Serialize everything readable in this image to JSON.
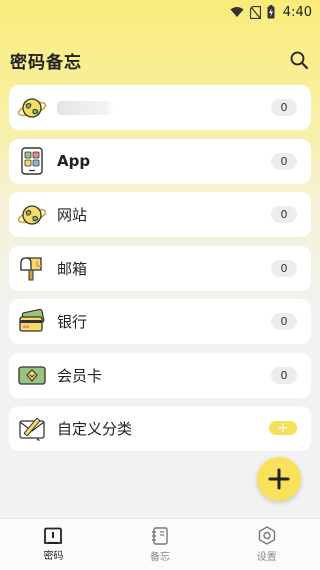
{
  "status_bar": {
    "time": "4:40",
    "icons": [
      "wifi-icon",
      "no-sim-icon",
      "battery-charging-icon"
    ]
  },
  "header": {
    "title": "密码备忘",
    "search_icon": "search-icon"
  },
  "categories": [
    {
      "label": "",
      "count": "0",
      "icon": "globe-icon",
      "label_redacted": true
    },
    {
      "label": "App",
      "count": "0",
      "icon": "phone-app-icon"
    },
    {
      "label": "网站",
      "count": "0",
      "icon": "globe-icon"
    },
    {
      "label": "邮箱",
      "count": "0",
      "icon": "mailbox-icon"
    },
    {
      "label": "银行",
      "count": "0",
      "icon": "bank-card-icon"
    },
    {
      "label": "会员卡",
      "count": "0",
      "icon": "vip-card-icon"
    },
    {
      "label": "自定义分类",
      "badge": "+",
      "icon": "envelope-pencil-icon"
    }
  ],
  "fab": {
    "label": "+",
    "icon": "plus-icon"
  },
  "bottom_nav": [
    {
      "label": "密码",
      "icon": "password-icon",
      "active": true
    },
    {
      "label": "备忘",
      "icon": "notebook-icon",
      "active": false
    },
    {
      "label": "设置",
      "icon": "settings-hexagon-icon",
      "active": false
    }
  ],
  "colors": {
    "accent": "#f8e25b",
    "background": "#f2f2f2",
    "card": "#ffffff"
  }
}
